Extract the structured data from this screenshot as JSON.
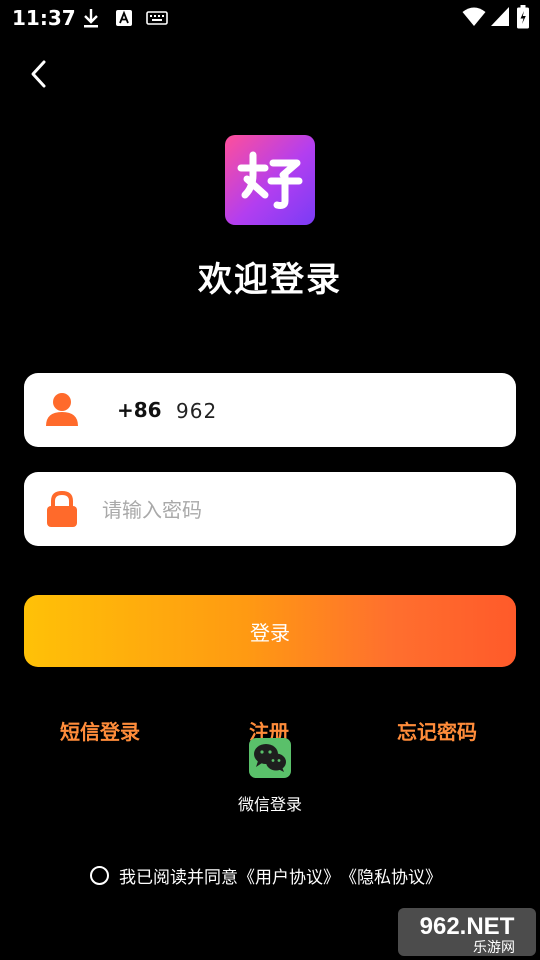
{
  "status_bar": {
    "time": "11:37",
    "icons": [
      "download-icon",
      "keyboard-a-icon",
      "keyboard-icon",
      "wifi-icon",
      "signal-icon",
      "battery-icon"
    ]
  },
  "header": {
    "back_icon": "chevron-left-icon"
  },
  "logo": {
    "icon": "app-logo-icon",
    "colors": [
      "#ff4f9a",
      "#b23ef0",
      "#7a3cf5"
    ]
  },
  "title": "欢迎登录",
  "phone": {
    "country_code": "+86",
    "value": "962",
    "icon": "user-icon"
  },
  "password": {
    "placeholder": "请输入密码",
    "value": "",
    "icon": "lock-icon"
  },
  "login_button": {
    "label": "登录",
    "gradient": [
      "#ffc107",
      "#ff5a2a"
    ]
  },
  "links": {
    "sms_login": "短信登录",
    "register": "注册",
    "forgot_password": "忘记密码"
  },
  "wechat": {
    "label": "微信登录",
    "icon": "wechat-icon"
  },
  "agreement": {
    "prefix": "我已阅读并同意",
    "user_agreement": "《用户协议》",
    "privacy_agreement": "《隐私协议》"
  },
  "watermark": {
    "brand": "962.NET",
    "sub": "乐游网"
  },
  "colors": {
    "accent": "#ff8c3a",
    "icon_orange": "#ff6a2b",
    "background": "#000000"
  }
}
